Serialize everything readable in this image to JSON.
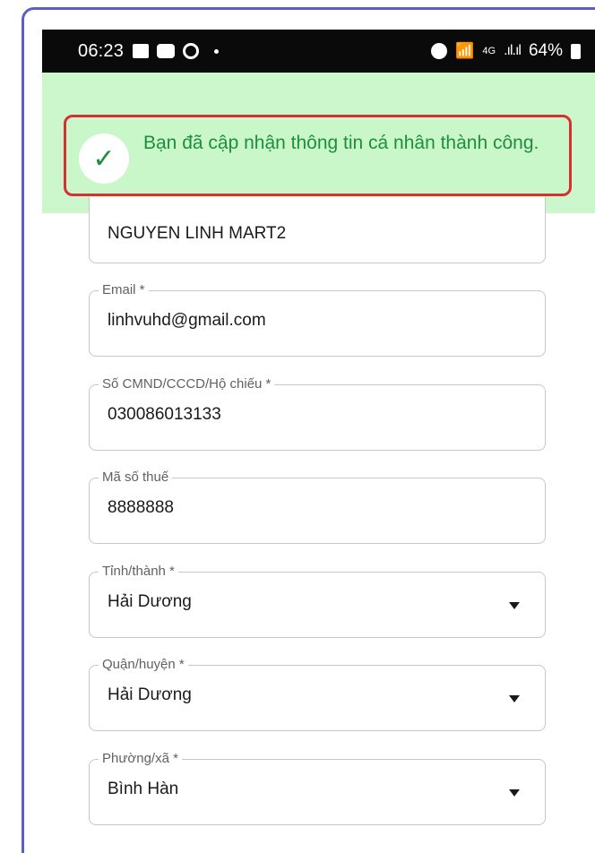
{
  "status_bar": {
    "time": "06:23",
    "network": "4G",
    "battery": "64%",
    "icons": [
      "gallery-icon",
      "zalo-icon",
      "chrome-icon",
      "dot-icon",
      "alarm-icon",
      "wifi-icon",
      "signal-icon",
      "battery-icon"
    ]
  },
  "toast": {
    "message": "Bạn đã cập nhận thông tin cá nhân thành công.",
    "icon": "check-icon",
    "text_color": "#1e8e3e",
    "background": "#ccf7cc",
    "highlight_border": "#d63031"
  },
  "form": {
    "name": {
      "value": "NGUYEN LINH MART2"
    },
    "email": {
      "label": "Email *",
      "value": "linhvuhd@gmail.com"
    },
    "id_number": {
      "label": "Số CMND/CCCD/Hộ chiếu *",
      "value": "030086013133"
    },
    "tax_code": {
      "label": "Mã số thuế",
      "value": "8888888"
    },
    "province": {
      "label": "Tỉnh/thành *",
      "value": "Hải Dương"
    },
    "district": {
      "label": "Quận/huyện *",
      "value": "Hải Dương"
    },
    "ward": {
      "label": "Phường/xã *",
      "value": "Bình Hàn"
    }
  }
}
